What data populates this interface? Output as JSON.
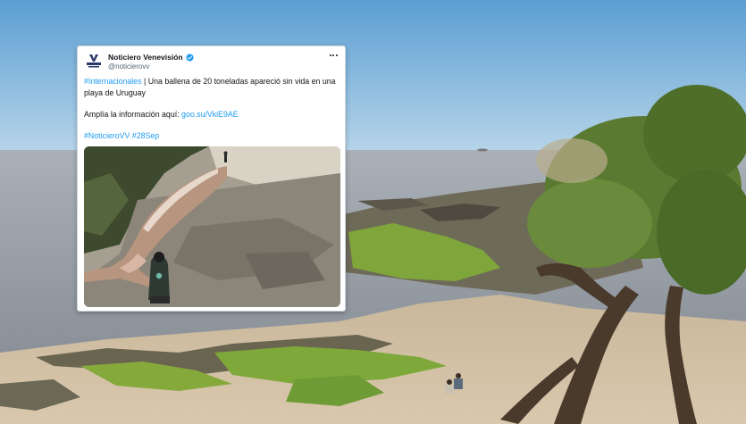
{
  "tweet": {
    "display_name": "Noticiero Venevisión",
    "handle": "@noticierovv",
    "logo_text": "VENEVISION",
    "line1_hashtag": "#Internacionales",
    "line1_text": " | Una ballena de 20 toneladas apareció sin vida en una playa de Uruguay",
    "line2_text": "Amplía la información aquí: ",
    "line2_link": "goo.su/VkiE9AE",
    "hashtag_1": "#NoticieroVV",
    "hashtag_2": "#28Sep",
    "verified_icon": "verified-badge-icon",
    "more_icon": "more-options-icon"
  },
  "colors": {
    "link": "#1d9bf0",
    "text": "#0f1419",
    "muted": "#536471",
    "verified": "#1d9bf0"
  }
}
